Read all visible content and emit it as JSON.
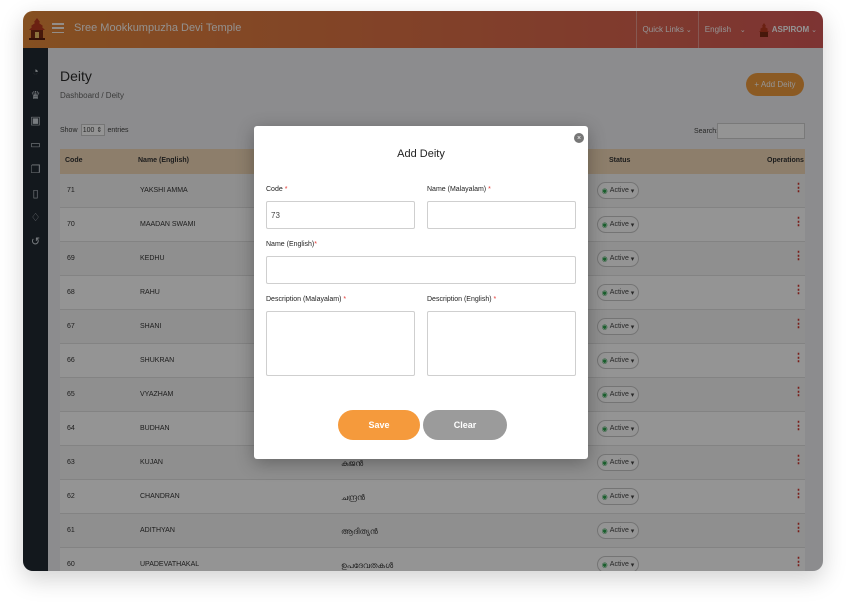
{
  "app": {
    "title": "Sree Mookkumpuzha Devi Temple"
  },
  "topbar": {
    "quick_links": "Quick Links",
    "language": "English",
    "user": "ASPIROM"
  },
  "page": {
    "title": "Deity",
    "breadcrumb": "Dashboard / Deity",
    "add_button": "+ Add Deity"
  },
  "list_controls": {
    "show": "Show",
    "entries_value": "100",
    "entries": "entries",
    "search_label": "Search:"
  },
  "table": {
    "headers": {
      "code": "Code",
      "name_english": "Name (English)",
      "status": "Status",
      "operations": "Operations"
    },
    "rows": [
      {
        "code": "71",
        "name": "YAKSHI AMMA",
        "malayalam": "",
        "status": "Active"
      },
      {
        "code": "70",
        "name": "MAADAN SWAMI",
        "malayalam": "",
        "status": "Active"
      },
      {
        "code": "69",
        "name": "KEDHU",
        "malayalam": "",
        "status": "Active"
      },
      {
        "code": "68",
        "name": "RAHU",
        "malayalam": "",
        "status": "Active"
      },
      {
        "code": "67",
        "name": "SHANI",
        "malayalam": "",
        "status": "Active"
      },
      {
        "code": "66",
        "name": "SHUKRAN",
        "malayalam": "",
        "status": "Active"
      },
      {
        "code": "65",
        "name": "VYAZHAM",
        "malayalam": "",
        "status": "Active"
      },
      {
        "code": "64",
        "name": "BUDHAN",
        "malayalam": "",
        "status": "Active"
      },
      {
        "code": "63",
        "name": "KUJAN",
        "malayalam": "കുജൻ",
        "status": "Active"
      },
      {
        "code": "62",
        "name": "CHANDRAN",
        "malayalam": "ചന്ദ്രൻ",
        "status": "Active"
      },
      {
        "code": "61",
        "name": "ADITHYAN",
        "malayalam": "ആദിത്യൻ",
        "status": "Active"
      },
      {
        "code": "60",
        "name": "UPADEVATHAKAL",
        "malayalam": "ഉപദേവതകൾ",
        "status": "Active"
      }
    ]
  },
  "modal": {
    "title": "Add Deity",
    "code_label": "Code",
    "code_value": "73",
    "name_ml_label": "Name (Malayalam)",
    "name_en_label": "Name (English)",
    "desc_ml_label": "Description (Malayalam)",
    "desc_en_label": "Description (English)",
    "required": "*",
    "save": "Save",
    "clear": "Clear",
    "close": "×"
  },
  "colors": {
    "accent": "#f09b3d",
    "topbar_start": "#e58a3a",
    "topbar_end": "#d85a58",
    "sidebar": "#222a33",
    "table_header": "#f3d9b8",
    "status_dot": "#2ea44f",
    "kebab": "#d0342c"
  },
  "icons": [
    "temple-logo-icon",
    "menu-icon",
    "dashboard-icon",
    "deity-icon",
    "currency-icon",
    "ticket-icon",
    "copy-icon",
    "book-icon",
    "bell-icon",
    "refresh-icon",
    "kebab-icon",
    "close-icon"
  ]
}
